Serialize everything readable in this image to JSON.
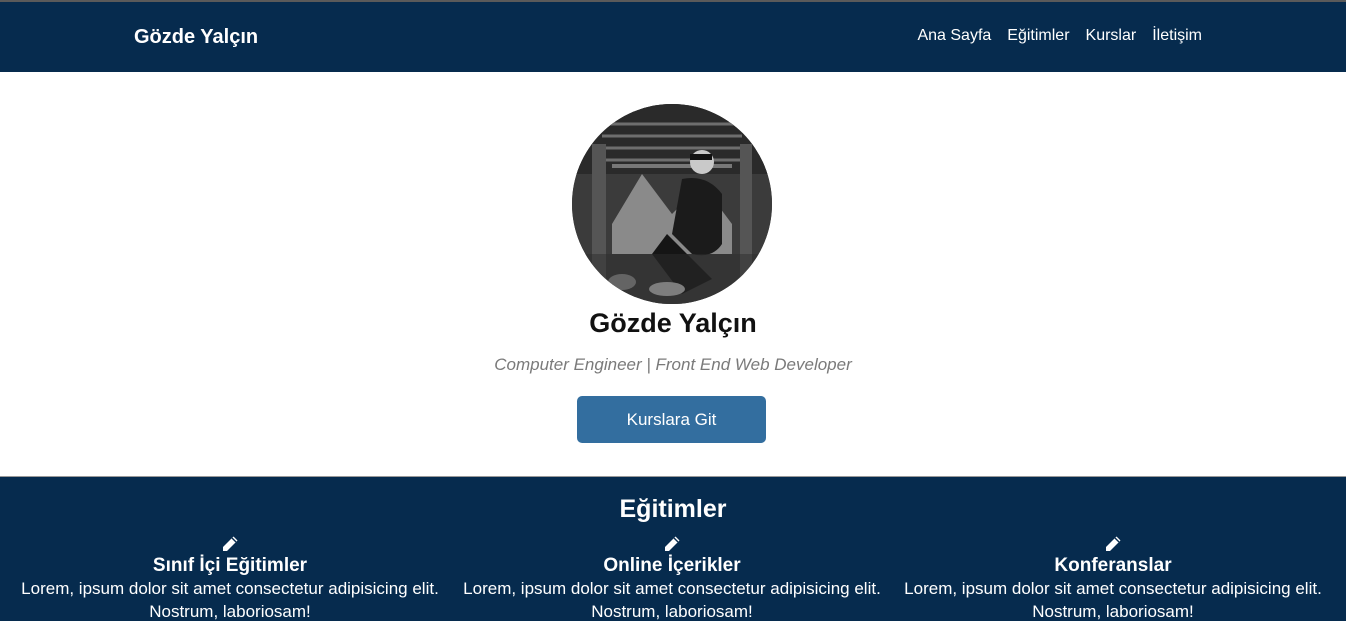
{
  "navbar": {
    "brand": "Gözde Yalçın",
    "links": [
      "Ana Sayfa",
      "Eğitimler",
      "Kurslar",
      "İletişim"
    ]
  },
  "hero": {
    "name": "Gözde Yalçın",
    "subtitle": "Computer Engineer | Front End Web Developer",
    "button_label": "Kurslara Git"
  },
  "education": {
    "title": "Eğitimler",
    "cards": [
      {
        "icon": "pencil-icon",
        "title": "Sınıf İçi Eğitimler",
        "text": "Lorem, ipsum dolor sit amet consectetur adipisicing elit. Nostrum, laboriosam!"
      },
      {
        "icon": "pencil-icon",
        "title": "Online İçerikler",
        "text": "Lorem, ipsum dolor sit amet consectetur adipisicing elit. Nostrum, laboriosam!"
      },
      {
        "icon": "pencil-icon",
        "title": "Konferanslar",
        "text": "Lorem, ipsum dolor sit amet consectetur adipisicing elit. Nostrum, laboriosam!"
      }
    ]
  },
  "colors": {
    "navbar_bg": "#062b4e",
    "button_bg": "#336e9f",
    "subtitle": "#7a7a7a"
  }
}
